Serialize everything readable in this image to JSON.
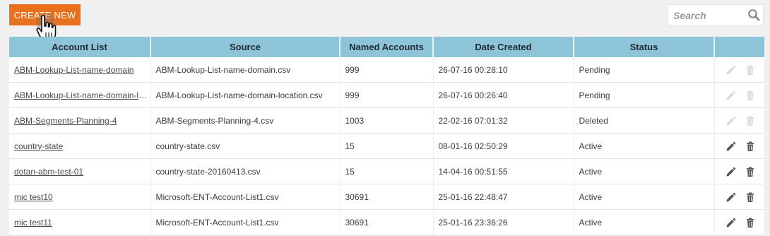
{
  "toolbar": {
    "create_label": "CREATE NEW",
    "search_placeholder": "Search",
    "search_value": ""
  },
  "table": {
    "columns": [
      "Account List",
      "Source",
      "Named Accounts",
      "Date Created",
      "Status",
      ""
    ],
    "rows": [
      {
        "name": "ABM-Lookup-List-name-domain",
        "source": "ABM-Lookup-List-name-domain.csv",
        "count": "999",
        "date": "26-07-16 00:28:10",
        "status": "Pending"
      },
      {
        "name": "ABM-Lookup-List-name-domain-location",
        "source": "ABM-Lookup-List-name-domain-location.csv",
        "count": "999",
        "date": "26-07-16 00:26:40",
        "status": "Pending"
      },
      {
        "name": "ABM-Segments-Planning-4",
        "source": "ABM-Segments-Planning-4.csv",
        "count": "1003",
        "date": "22-02-16 07:01:32",
        "status": "Deleted"
      },
      {
        "name": "country-state",
        "source": "country-state.csv",
        "count": "15",
        "date": "08-01-16 02:50:29",
        "status": "Active"
      },
      {
        "name": "dotan-abm-test-01",
        "source": "country-state-20160413.csv",
        "count": "15",
        "date": "14-04-16 00:51:55",
        "status": "Active"
      },
      {
        "name": "mic test10",
        "source": "Microsoft-ENT-Account-List1.csv",
        "count": "30691",
        "date": "25-01-16 22:48:47",
        "status": "Active"
      },
      {
        "name": "mic test11",
        "source": "Microsoft-ENT-Account-List1.csv",
        "count": "30691",
        "date": "25-01-16 23:36:26",
        "status": "Active"
      }
    ]
  },
  "colors": {
    "accent": "#e8701e",
    "header_bg": "#8dc4d8",
    "page_bg": "#f0f0f0"
  },
  "icons": {
    "edit": "pencil-icon",
    "delete": "trash-icon",
    "search": "search-icon",
    "cursor": "hand-pointer-icon"
  }
}
